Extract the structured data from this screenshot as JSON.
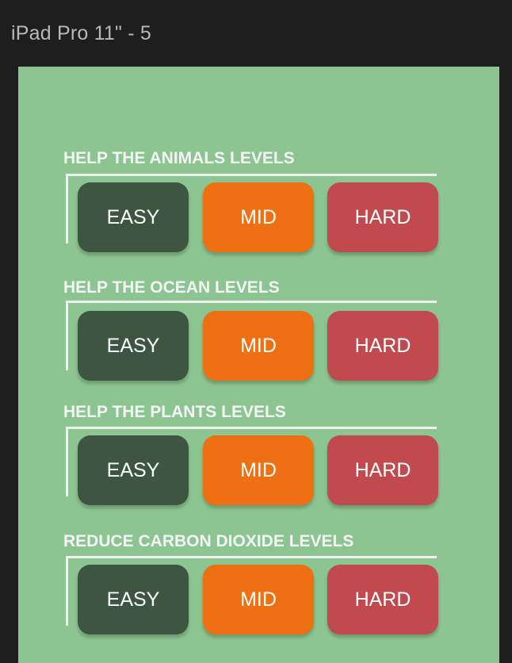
{
  "frame": {
    "title": "iPad Pro 11\" - 5"
  },
  "sections": [
    {
      "title": "HELP THE ANIMALS LEVELS",
      "easy": "EASY",
      "mid": "MID",
      "hard": "HARD"
    },
    {
      "title": "HELP THE OCEAN LEVELS",
      "easy": "EASY",
      "mid": "MID",
      "hard": "HARD"
    },
    {
      "title": "HELP THE PLANTS LEVELS",
      "easy": "EASY",
      "mid": "MID",
      "hard": "HARD"
    },
    {
      "title": "REDUCE CARBON DIOXIDE LEVELS",
      "easy": "EASY",
      "mid": "MID",
      "hard": "HARD"
    }
  ],
  "colors": {
    "background": "#1e1e1e",
    "artboard": "#8cc592",
    "easy": "#3e5542",
    "mid": "#ef7012",
    "hard": "#c14a4e",
    "text": "#ffffff"
  }
}
